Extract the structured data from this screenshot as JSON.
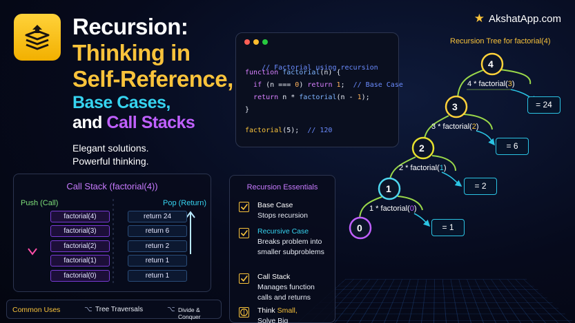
{
  "brand": {
    "name": "AkshatApp.com"
  },
  "hero": {
    "title_1": "Recursion:",
    "title_2": "Thinking in",
    "title_3": "Self-Reference,",
    "title_4": "Base Cases,",
    "title_5_and": "and",
    "title_5_rest": "Call Stacks",
    "tagline_1": "Elegant solutions.",
    "tagline_2": "Powerful thinking."
  },
  "code": {
    "lines": [
      "// Factorial using recursion",
      "function factorial(n) {",
      "  if (n === 0) return 1;  // Base Case",
      "  return n * factorial(n - 1);",
      "}",
      "factorial(5);  // 120"
    ],
    "parts": {
      "comment1": "// Factorial using recursion",
      "kw_function": "function",
      "fn_name": "factorial",
      "params": "(n) {",
      "kw_if": "if",
      "cond": "(n === ",
      "zero": "0",
      "cond_end": ") ",
      "kw_return": "return",
      "one": "1",
      "semi": ";",
      "base_comment": "// Base Case",
      "ret_expr_1": " n * ",
      "ret_expr_2": "(n - ",
      "ret_expr_3": ");",
      "close": "}",
      "call": "factorial",
      "call_args": "(5);",
      "call_comment": "// 120"
    }
  },
  "tree": {
    "title": "Recursion Tree for factorial(4)",
    "nodes": [
      {
        "num": "4",
        "call_pre": "4 * factorial(",
        "call_arg": "3",
        "call_post": ")",
        "result": "= 24"
      },
      {
        "num": "3",
        "call_pre": "3 * factorial(",
        "call_arg": "2",
        "call_post": ")",
        "result": "= 6"
      },
      {
        "num": "2",
        "call_pre": "2 * factorial(",
        "call_arg": "1",
        "call_post": ")",
        "result": "= 2"
      },
      {
        "num": "1",
        "call_pre": "1 * factorial(",
        "call_arg": "0",
        "call_post": ")",
        "result": "= 1"
      },
      {
        "num": "0"
      }
    ]
  },
  "call_stack": {
    "title": "Call Stack (factorial(4))",
    "push_label": "Push (Call)",
    "pop_label": "Pop (Return)",
    "frames": [
      "factorial(4)",
      "factorial(3)",
      "factorial(2)",
      "factorial(1)",
      "factorial(0)"
    ],
    "returns": [
      "return 24",
      "return 6",
      "return 2",
      "return 1",
      "return 1"
    ]
  },
  "essentials": {
    "title": "Recursion Essentials",
    "items": [
      {
        "head": "Base Case",
        "desc": "Stops recursion"
      },
      {
        "head": "Recursive Case",
        "desc": "Breaks problem into smaller subproblems"
      },
      {
        "head": "Call Stack",
        "desc": "Manages function calls and returns"
      },
      {
        "head_pre": "Think ",
        "head_em": "Small,",
        "desc": "Solve Big"
      }
    ]
  },
  "uses": {
    "label": "Common Uses",
    "items": [
      "Tree Traversals",
      "Divide & Conquer"
    ]
  },
  "colors": {
    "yellow": "#f9c33b",
    "cyan": "#36d4f0",
    "purple": "#c060ff",
    "green": "#7ee07a",
    "pink": "#ff5fb0"
  }
}
